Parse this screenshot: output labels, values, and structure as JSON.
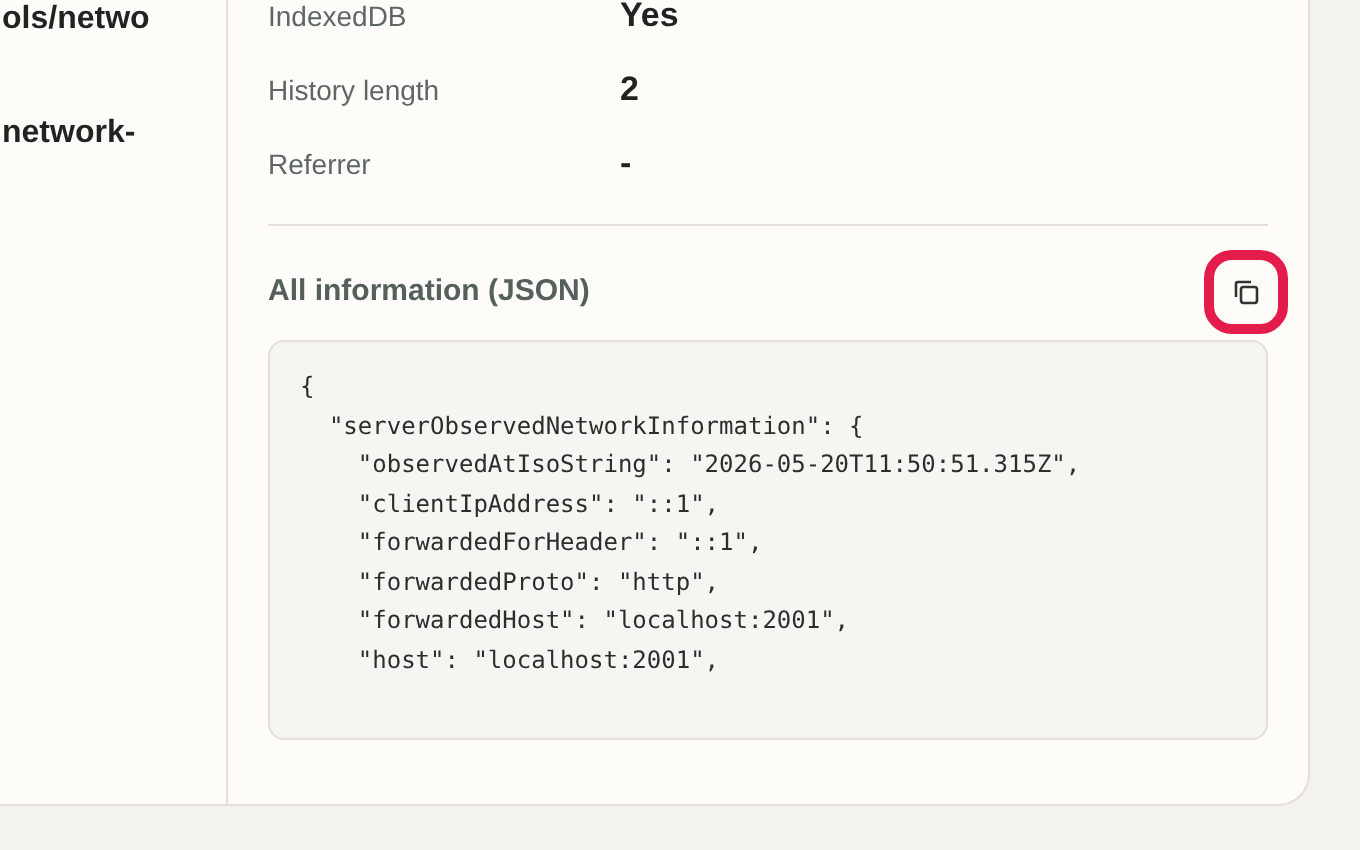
{
  "left_column": {
    "lines": [
      "ols/netwo",
      "network-"
    ]
  },
  "info_rows": [
    {
      "label": "IndexedDB",
      "value": "Yes"
    },
    {
      "label": "History length",
      "value": "2"
    },
    {
      "label": "Referrer",
      "value": "-"
    }
  ],
  "json_section": {
    "title": "All information (JSON)",
    "copy_button": {
      "highlighted": true
    },
    "code_lines": [
      "{",
      "  \"serverObservedNetworkInformation\": {",
      "    \"observedAtIsoString\": \"2026-05-20T11:50:51.315Z\",",
      "    \"clientIpAddress\": \"::1\",",
      "    \"forwardedForHeader\": \"::1\",",
      "    \"forwardedProto\": \"http\",",
      "    \"forwardedHost\": \"localhost:2001\",",
      "    \"host\": \"localhost:2001\","
    ]
  }
}
